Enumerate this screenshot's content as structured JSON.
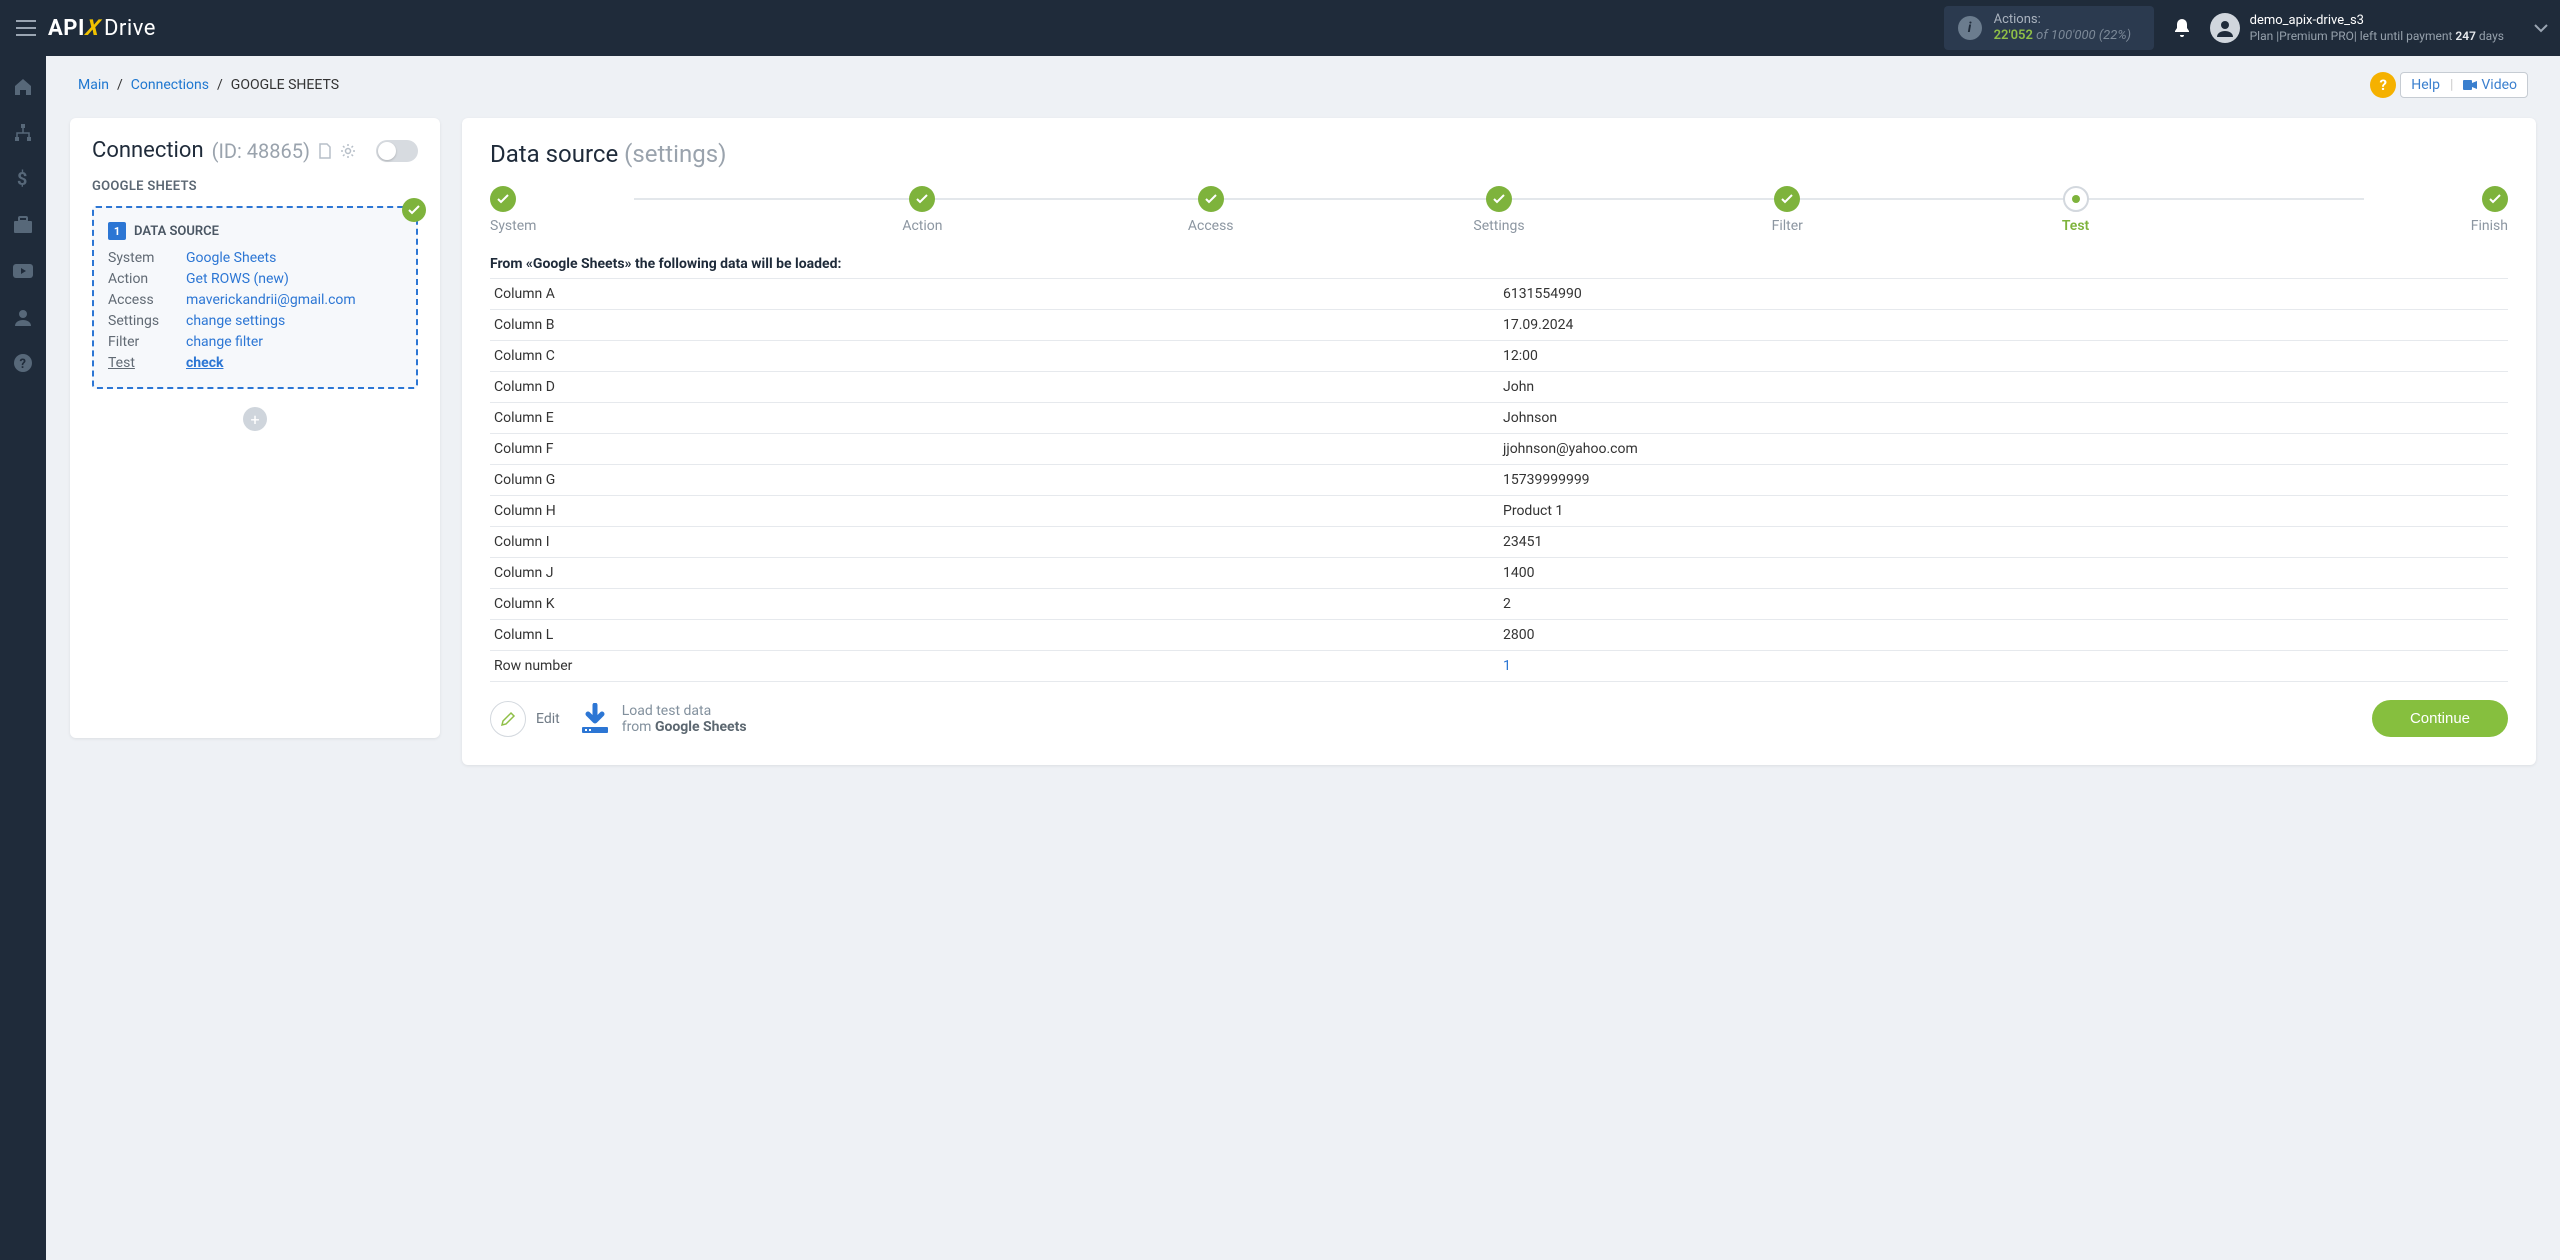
{
  "header": {
    "logo": {
      "api": "API",
      "x": "X",
      "drive": "Drive"
    },
    "actions": {
      "label": "Actions:",
      "used": "22'052",
      "of_word": "of",
      "limit": "100'000",
      "pct": "(22%)"
    },
    "user": {
      "name": "demo_apix-drive_s3",
      "plan_prefix": "Plan |",
      "plan_name": "Premium PRO",
      "plan_mid": "| left until payment ",
      "days": "247",
      "days_word": " days"
    }
  },
  "breadcrumb": {
    "main": "Main",
    "connections": "Connections",
    "current": "GOOGLE SHEETS"
  },
  "help": {
    "help": "Help",
    "video": "Video"
  },
  "connection_card": {
    "title": "Connection",
    "id_label": "(ID: 48865)",
    "subhead": "GOOGLE SHEETS",
    "box_num": "1",
    "box_title": "DATA SOURCE",
    "rows": {
      "system": {
        "lbl": "System",
        "val": "Google Sheets"
      },
      "action": {
        "lbl": "Action",
        "val": "Get ROWS (new)"
      },
      "access": {
        "lbl": "Access",
        "val": "maverickandrii@gmail.com"
      },
      "settings": {
        "lbl": "Settings",
        "val": "change settings"
      },
      "filter": {
        "lbl": "Filter",
        "val": "change filter"
      },
      "test": {
        "lbl": "Test",
        "val": "check"
      }
    }
  },
  "main_panel": {
    "title": "Data source",
    "subtitle": "(settings)",
    "steps": [
      {
        "label": "System",
        "state": "done"
      },
      {
        "label": "Action",
        "state": "done"
      },
      {
        "label": "Access",
        "state": "done"
      },
      {
        "label": "Settings",
        "state": "done"
      },
      {
        "label": "Filter",
        "state": "done"
      },
      {
        "label": "Test",
        "state": "active"
      },
      {
        "label": "Finish",
        "state": "pending"
      }
    ],
    "from_line": "From «Google Sheets» the following data will be loaded:",
    "table": [
      {
        "k": "Column A",
        "v": "6131554990"
      },
      {
        "k": "Column B",
        "v": "17.09.2024"
      },
      {
        "k": "Column C",
        "v": "12:00"
      },
      {
        "k": "Column D",
        "v": "John"
      },
      {
        "k": "Column E",
        "v": "Johnson"
      },
      {
        "k": "Column F",
        "v": "jjohnson@yahoo.com"
      },
      {
        "k": "Column G",
        "v": "15739999999"
      },
      {
        "k": "Column H",
        "v": "Product 1"
      },
      {
        "k": "Column I",
        "v": "23451"
      },
      {
        "k": "Column J",
        "v": "1400"
      },
      {
        "k": "Column K",
        "v": "2"
      },
      {
        "k": "Column L",
        "v": "2800"
      },
      {
        "k": "Row number",
        "v": "1",
        "link": true
      }
    ],
    "edit_label": "Edit",
    "load_l1": "Load test data",
    "load_l2_prefix": "from ",
    "load_l2_bold": "Google Sheets",
    "continue": "Continue"
  }
}
